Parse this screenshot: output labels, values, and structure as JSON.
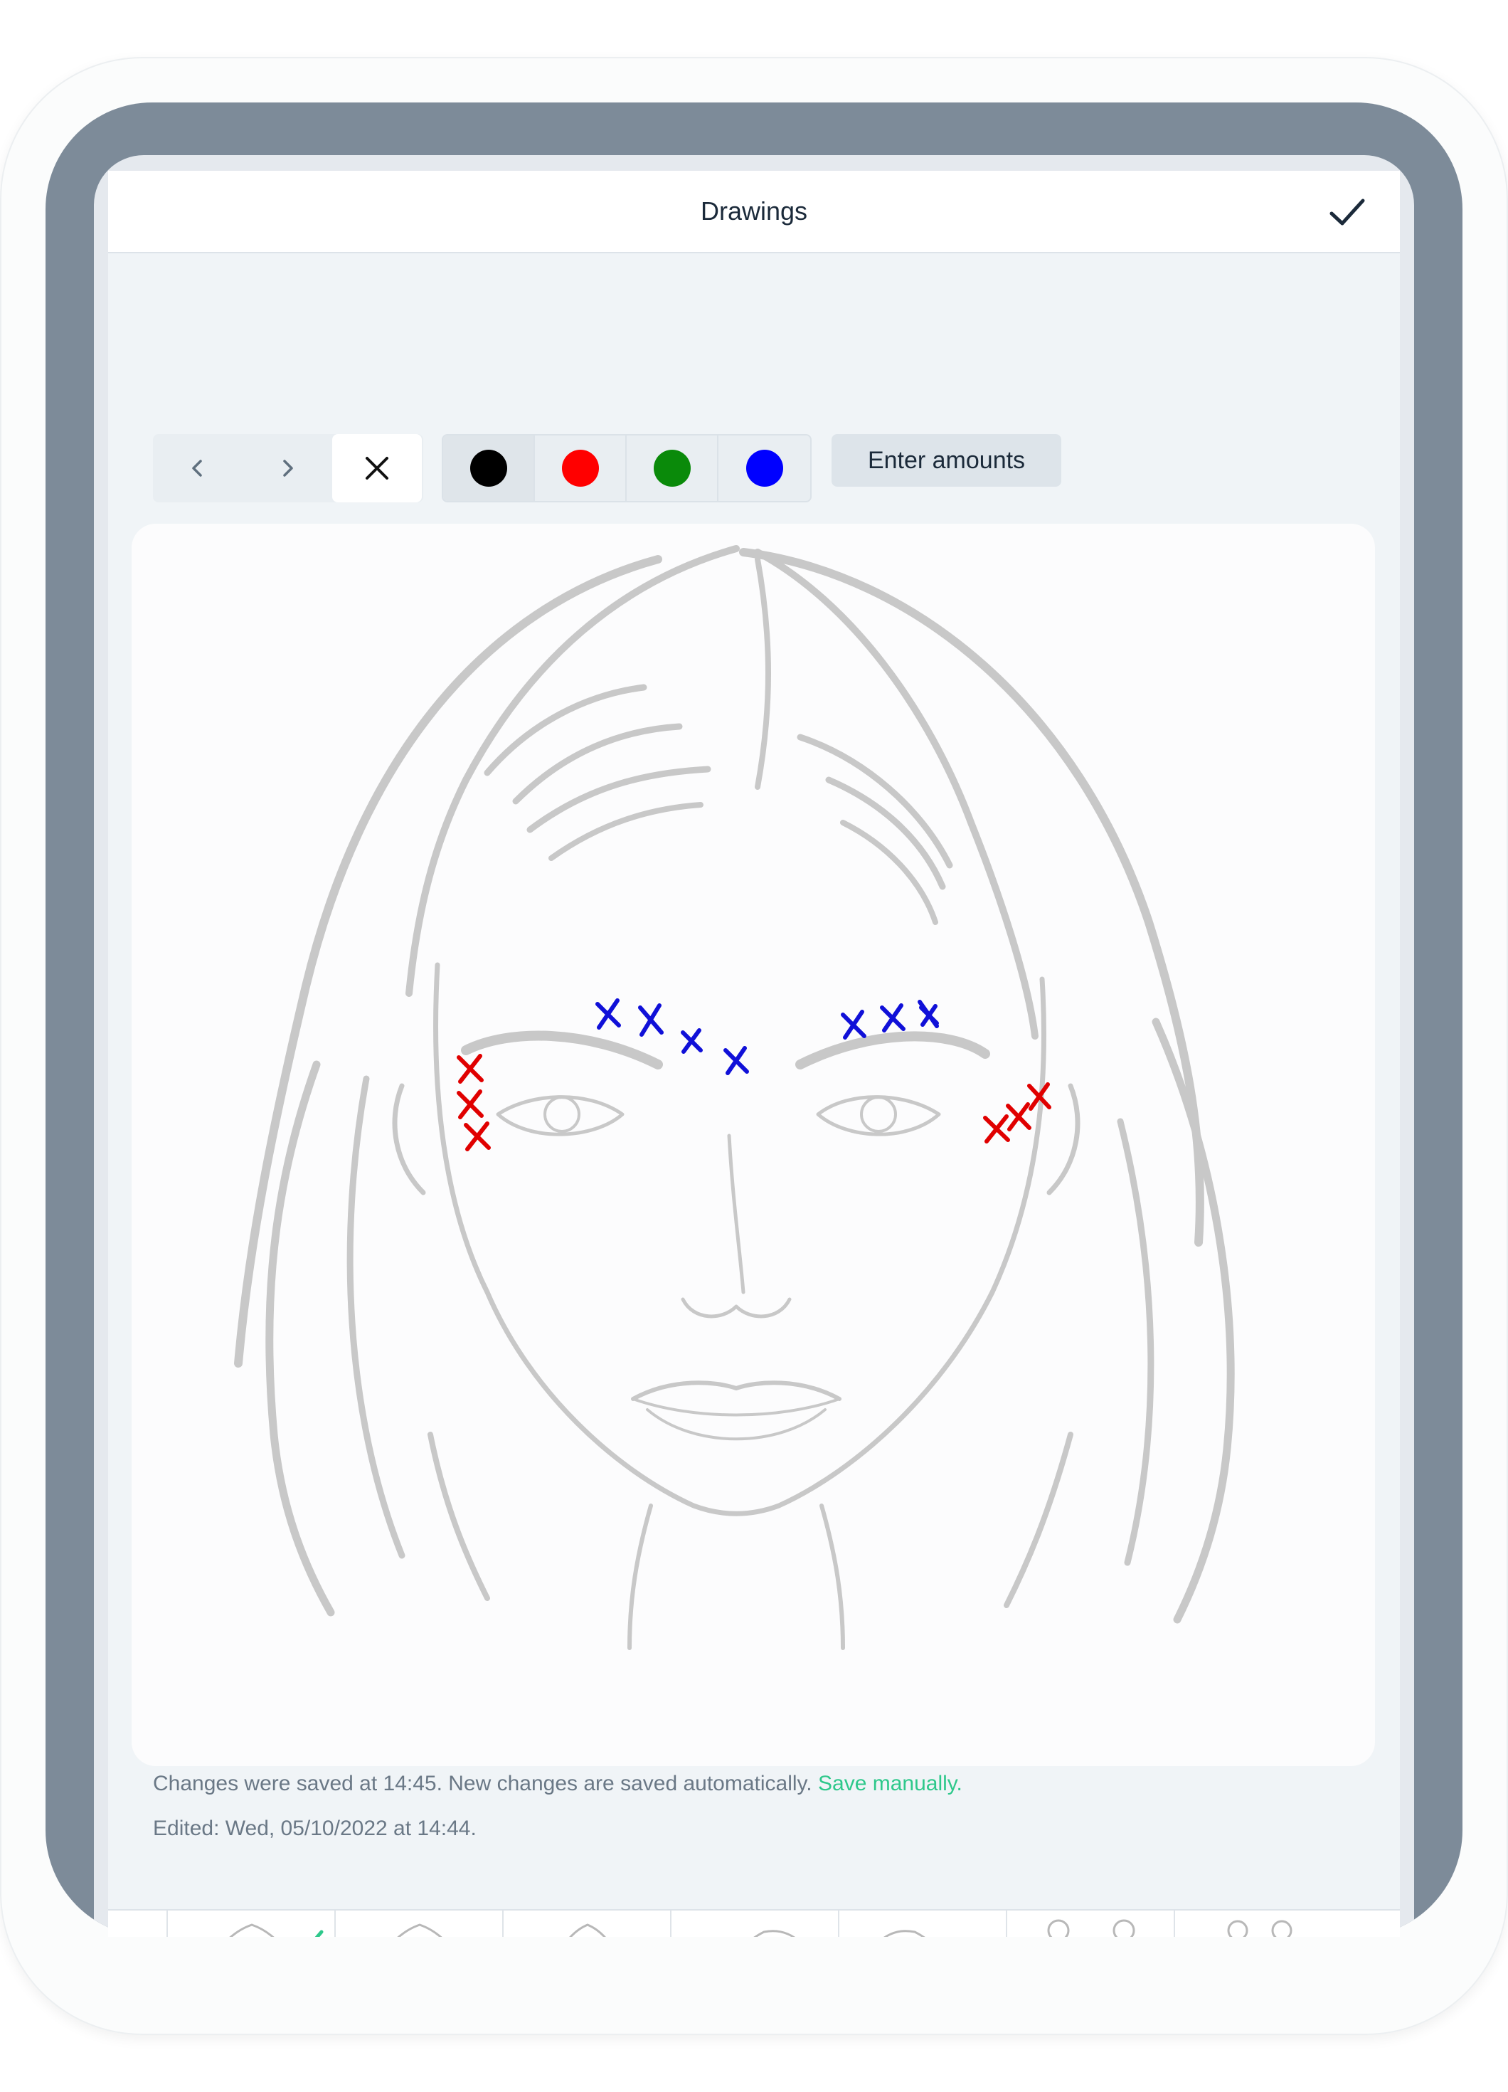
{
  "header": {
    "title": "Drawings",
    "done_icon": "checkmark-icon"
  },
  "toolbar": {
    "nav_buttons": [
      {
        "name": "undo",
        "icon": "chevron-left-icon"
      },
      {
        "name": "redo",
        "icon": "chevron-right-icon"
      },
      {
        "name": "clear",
        "icon": "close-icon"
      }
    ],
    "colors": [
      {
        "name": "black",
        "hex": "#000000",
        "selected": true
      },
      {
        "name": "red",
        "hex": "#ff0000",
        "selected": false
      },
      {
        "name": "green",
        "hex": "#0a8a0a",
        "selected": false
      },
      {
        "name": "blue",
        "hex": "#0000ff",
        "selected": false
      }
    ],
    "enter_amounts_label": "Enter amounts"
  },
  "canvas": {
    "template": "female-face-front",
    "marker_colors": {
      "blue": "#1010d8",
      "red": "#e00000"
    },
    "marker_counts": {
      "blue": 8,
      "red": 6
    }
  },
  "status": {
    "saved_text": "Changes were saved at 14:45. New changes are saved automatically.",
    "save_link": "Save manually.",
    "edited_text": "Edited: Wed, 05/10/2022 at 14:44."
  },
  "thumbnails": [
    {
      "name": "face-front",
      "selected": true
    },
    {
      "name": "face-front-alt",
      "selected": false
    },
    {
      "name": "face-front-neutral",
      "selected": false
    },
    {
      "name": "face-profile-left",
      "selected": false
    },
    {
      "name": "face-profile-right",
      "selected": false
    },
    {
      "name": "body-front-back",
      "selected": false
    },
    {
      "name": "body-side",
      "selected": false
    }
  ],
  "colors": {
    "accent": "#2ec88b",
    "text": "#1b2a3a",
    "muted": "#6a7886"
  }
}
